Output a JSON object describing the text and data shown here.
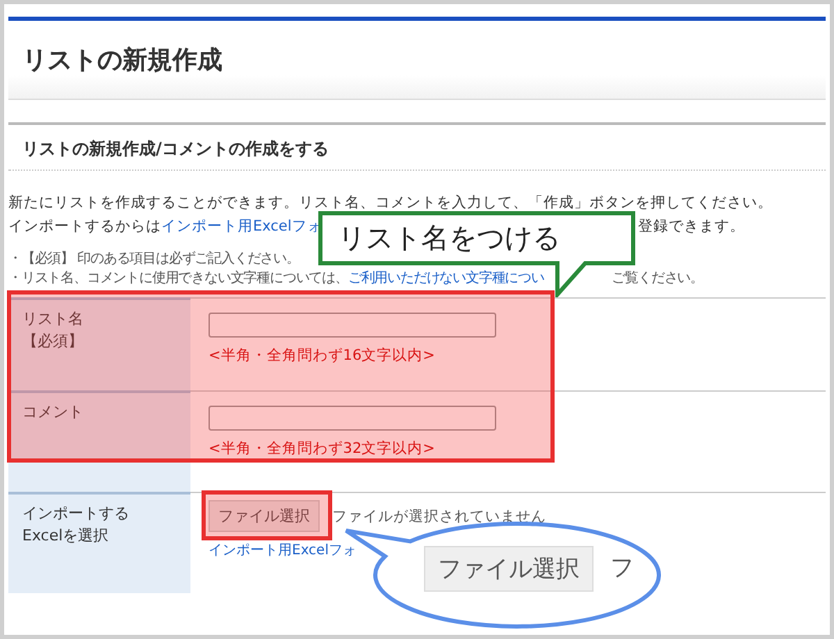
{
  "page_title": "リストの新規作成",
  "section_heading": "リストの新規作成/コメントの作成をする",
  "intro": {
    "line_1": "新たにリストを作成することができます。リスト名、コメントを入力して、「作成」ボタンを押してください。",
    "line_2_text": "インポートするからは",
    "line_2_link": "インポート用Excelフォ",
    "line_2_tail": "登録できます。"
  },
  "notes": [
    {
      "text": "・【必須】 印のある項目は必ずご記入ください。"
    },
    {
      "text": "・リスト名、コメントに使用できない文字種については、",
      "link": "ご利用いただけない文字種につい",
      "tail": "ご覧ください。"
    }
  ],
  "form_rows": [
    {
      "kind": "text",
      "label": "リスト名",
      "required": "【必須】",
      "hint": "<半角・全角問わず16文字以内>"
    },
    {
      "kind": "text",
      "label": "コメント",
      "hint": "<半角・全角問わず32文字以内>"
    },
    {
      "kind": "file",
      "label": "インポートする\nExcelを選択",
      "button": "ファイル選択",
      "status": "ファイルが選択されていません",
      "link": "インポート用Excelフォ"
    }
  ],
  "annotations": {
    "callout": "リスト名をつける",
    "magnifier_button": "ファイル選択",
    "magnifier_tail": "フ"
  }
}
